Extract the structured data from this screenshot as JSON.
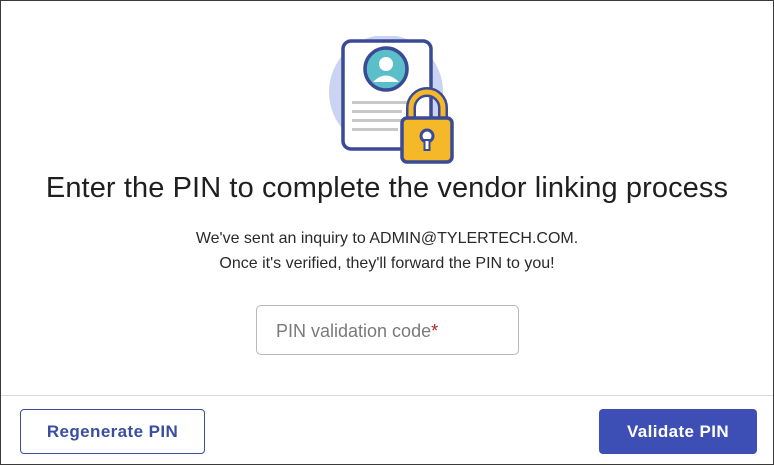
{
  "dialog": {
    "title": "Enter the PIN to complete the vendor linking process",
    "message_line1": "We've sent an inquiry to ADMIN@TYLERTECH.COM.",
    "message_line2": "Once it's verified, they'll forward the PIN to you!",
    "pin_field": {
      "placeholder": "PIN validation code",
      "required_marker": "*",
      "value": ""
    },
    "icons": {
      "illustration": "profile-document-lock-icon"
    }
  },
  "footer": {
    "regenerate_label": "Regenerate PIN",
    "validate_label": "Validate PIN"
  },
  "colors": {
    "primary": "#3d4fb5",
    "outline_text": "#3a4ea1",
    "lock": "#f5b829",
    "avatar": "#5bbfc9",
    "required": "#b3261e"
  }
}
